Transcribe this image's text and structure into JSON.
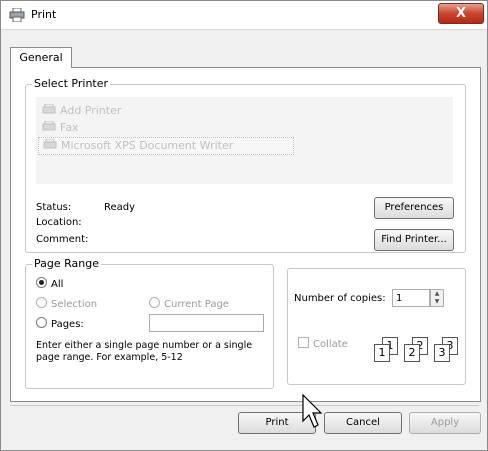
{
  "window": {
    "title": "Print",
    "close_label": "X"
  },
  "tab": {
    "label": "General"
  },
  "select_printer": {
    "label": "Select Printer",
    "printers": [
      {
        "name": "Add Printer",
        "icon": "add-printer-icon"
      },
      {
        "name": "Fax",
        "icon": "fax-icon"
      },
      {
        "name": "Microsoft XPS Document Writer",
        "icon": "printer-icon",
        "selected": true
      }
    ],
    "status_label": "Status:",
    "status_value": "Ready",
    "location_label": "Location:",
    "location_value": "",
    "comment_label": "Comment:",
    "comment_value": "",
    "preferences_button": "Preferences",
    "find_printer_button": "Find Printer..."
  },
  "page_range": {
    "label": "Page Range",
    "options": {
      "all": "All",
      "selection": "Selection",
      "current_page": "Current Page",
      "pages": "Pages:"
    },
    "selected": "all",
    "pages_value": "",
    "hint": "Enter either a single page number or a single page range.  For example, 5-12"
  },
  "copies": {
    "label": "Number of copies:",
    "value": "1",
    "collate_label": "Collate",
    "collate_checked": false,
    "collate_icons": [
      "1",
      "1",
      "2",
      "2",
      "3",
      "3"
    ]
  },
  "footer": {
    "print": "Print",
    "cancel": "Cancel",
    "apply": "Apply"
  }
}
